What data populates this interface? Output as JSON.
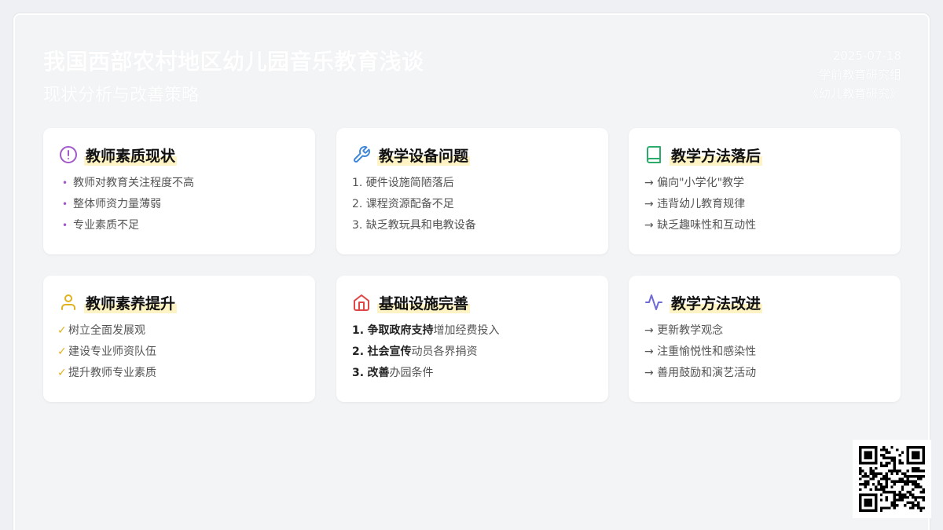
{
  "header": {
    "title": "我国西部农村地区幼儿园音乐教育浅谈",
    "subtitle": "现状分析与改善策略",
    "date": "2025-07-18",
    "author": "学前教育研究组",
    "publication": "《幼儿教育研究》"
  },
  "cards": [
    {
      "title": "教师素质现状",
      "icon": "alert-circle-icon",
      "icon_color": "#a259c9",
      "bullet_color": "#a259c9",
      "items": [
        "教师对教育关注程度不高",
        "整体师资力量薄弱",
        "专业素质不足"
      ]
    },
    {
      "title": "教学设备问题",
      "icon": "wrench-icon",
      "icon_color": "#3f86d9",
      "items": [
        "1. 硬件设施简陋落后",
        "2. 课程资源配备不足",
        "3. 缺乏教玩具和电教设备"
      ]
    },
    {
      "title": "教学方法落后",
      "icon": "book-icon",
      "icon_color": "#2dab6a",
      "items": [
        "→ 偏向\"小学化\"教学",
        "→ 违背幼儿教育规律",
        "→ 缺乏趣味性和互动性"
      ]
    },
    {
      "title": "教师素养提升",
      "icon": "user-icon",
      "icon_color": "#e0b21e",
      "check": "✓",
      "items": [
        "树立全面发展观",
        "建设专业师资队伍",
        "提升教师专业素质"
      ]
    },
    {
      "title": "基础设施完善",
      "icon": "home-icon",
      "icon_color": "#e04848",
      "items": [
        {
          "num": "1.",
          "strong": "争取政府支持",
          "rest": "增加经费投入"
        },
        {
          "num": "2.",
          "strong": "社会宣传",
          "rest": "动员各界捐资"
        },
        {
          "num": "3.",
          "strong": "改善",
          "rest": "办园条件"
        }
      ]
    },
    {
      "title": "教学方法改进",
      "icon": "activity-icon",
      "icon_color": "#6e6ad8",
      "items": [
        "→ 更新教学观念",
        "→ 注重愉悦性和感染性",
        "→ 善用鼓励和演艺活动"
      ]
    }
  ],
  "qr": {
    "icon": "qr-code-icon"
  }
}
